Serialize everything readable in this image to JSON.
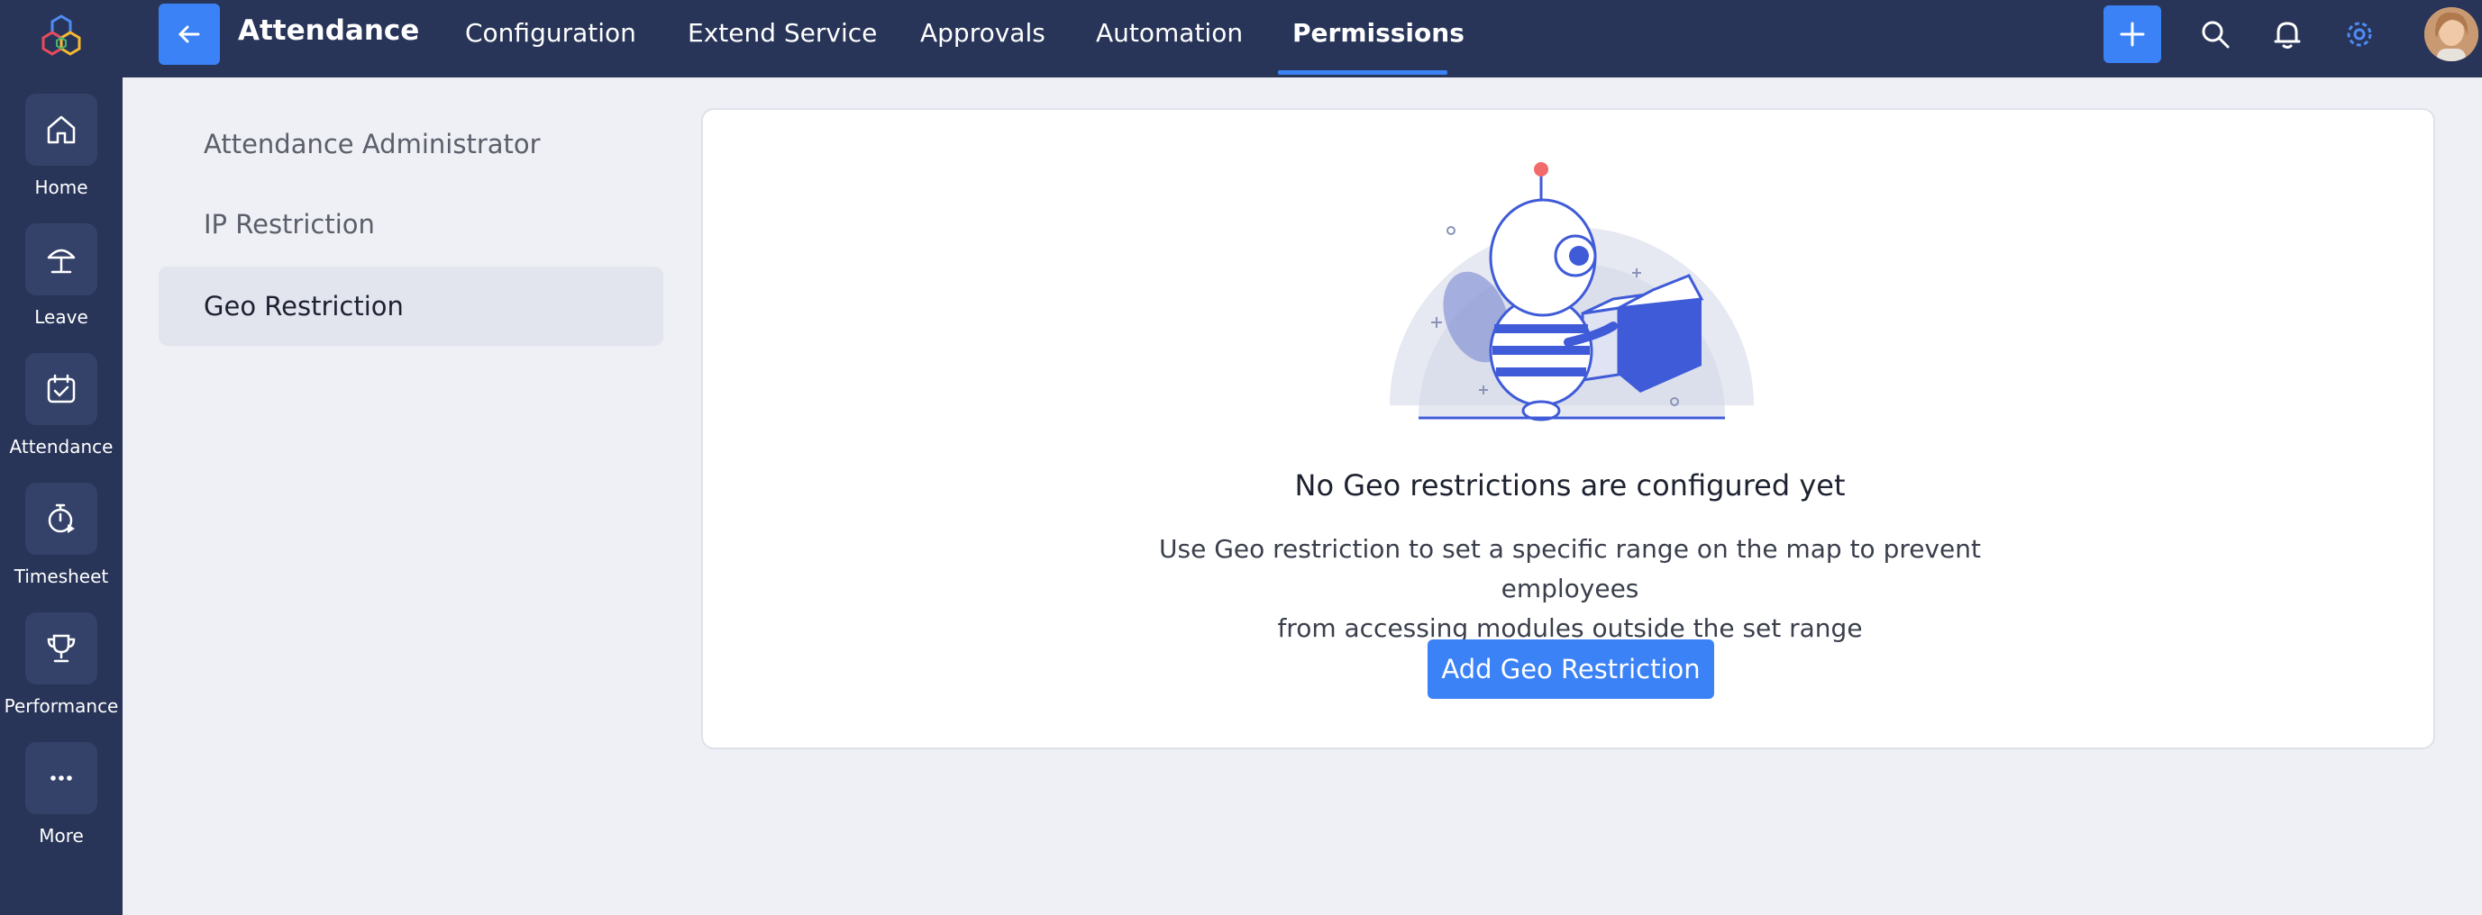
{
  "rail": {
    "items": [
      {
        "label": "Home",
        "icon": "home-icon"
      },
      {
        "label": "Leave",
        "icon": "umbrella-icon"
      },
      {
        "label": "Attendance",
        "icon": "calendar-check-icon"
      },
      {
        "label": "Timesheet",
        "icon": "stopwatch-icon"
      },
      {
        "label": "Performance",
        "icon": "trophy-icon"
      },
      {
        "label": "More",
        "icon": "more-dots-icon"
      }
    ]
  },
  "header": {
    "module_title": "Attendance",
    "tabs": [
      {
        "label": "Configuration"
      },
      {
        "label": "Extend Service"
      },
      {
        "label": "Approvals"
      },
      {
        "label": "Automation"
      },
      {
        "label": "Permissions",
        "active": true
      }
    ],
    "accent": "#3b82f6",
    "background": "#283558"
  },
  "submenu": {
    "items": [
      {
        "label": "Attendance Administrator"
      },
      {
        "label": "IP Restriction"
      },
      {
        "label": "Geo Restriction",
        "active": true
      }
    ]
  },
  "empty_state": {
    "title": "No Geo restrictions are configured yet",
    "description_line1": "Use Geo restriction to set a specific range on the map to prevent employees",
    "description_line2": "from accessing modules outside the set range",
    "button_label": "Add Geo Restriction",
    "illustration": "robot-with-box-illustration"
  }
}
